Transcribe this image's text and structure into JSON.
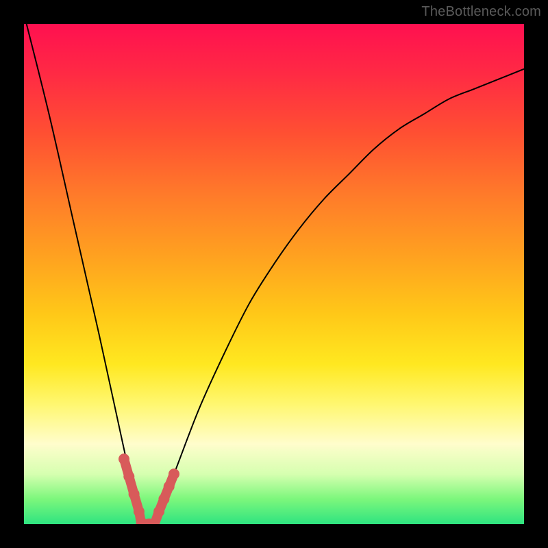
{
  "watermark": {
    "text": "TheBottleneck.com"
  },
  "chart_data": {
    "type": "line",
    "title": "",
    "xlabel": "",
    "ylabel": "",
    "series": [
      {
        "name": "curve",
        "x": [
          0.0,
          0.05,
          0.1,
          0.15,
          0.2,
          0.235,
          0.26,
          0.3,
          0.35,
          0.4,
          0.45,
          0.5,
          0.55,
          0.6,
          0.65,
          0.7,
          0.75,
          0.8,
          0.85,
          0.9,
          0.95,
          1.0
        ],
        "values": [
          1.02,
          0.82,
          0.6,
          0.38,
          0.15,
          0.0,
          0.0,
          0.1,
          0.23,
          0.34,
          0.44,
          0.52,
          0.59,
          0.65,
          0.7,
          0.75,
          0.79,
          0.82,
          0.85,
          0.87,
          0.89,
          0.91
        ]
      }
    ],
    "valley": {
      "x": [
        0.2,
        0.21,
        0.22,
        0.23,
        0.235,
        0.24,
        0.25,
        0.26,
        0.27,
        0.28,
        0.29,
        0.3
      ],
      "values": [
        0.13,
        0.095,
        0.06,
        0.025,
        0.0,
        0.0,
        0.0,
        0.0,
        0.025,
        0.05,
        0.075,
        0.1
      ]
    },
    "xlim": [
      0,
      1
    ],
    "ylim": [
      0,
      1
    ]
  }
}
